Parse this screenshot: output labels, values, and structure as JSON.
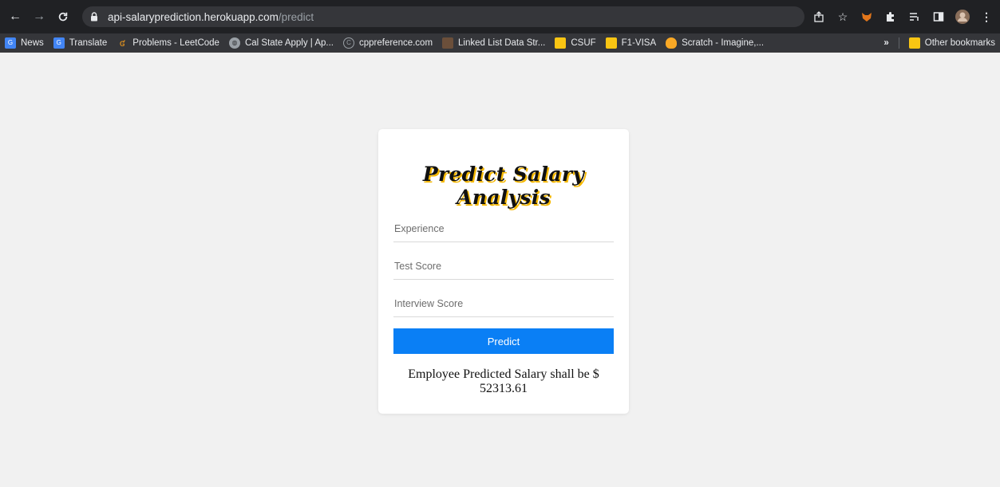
{
  "browser": {
    "url_host": "api-salaryprediction.herokuapp.com",
    "url_path": "/predict",
    "bookmarks": [
      {
        "label": "News",
        "color": "#4285f4",
        "icon": "news-icon"
      },
      {
        "label": "Translate",
        "color": "#4285f4",
        "icon": "translate-icon"
      },
      {
        "label": "Problems - LeetCode",
        "color": "#f89f1b",
        "icon": "leetcode-icon"
      },
      {
        "label": "Cal State Apply | Ap...",
        "color": "#9aa0a6",
        "icon": "globe-icon"
      },
      {
        "label": "cppreference.com",
        "color": "#9aa0a6",
        "icon": "cppreference-icon"
      },
      {
        "label": "Linked List Data Str...",
        "color": "#6b4f3a",
        "icon": "site-icon"
      },
      {
        "label": "CSUF",
        "color": "#f9c513",
        "icon": "folder-icon"
      },
      {
        "label": "F1-VISA",
        "color": "#f9c513",
        "icon": "folder-icon"
      },
      {
        "label": "Scratch - Imagine,...",
        "color": "#f9a825",
        "icon": "scratch-icon"
      }
    ],
    "more_label": "»",
    "other_bookmarks": "Other bookmarks"
  },
  "page": {
    "title": "Predict Salary Analysis",
    "fields": {
      "experience_placeholder": "Experience",
      "test_score_placeholder": "Test Score",
      "interview_score_placeholder": "Interview Score"
    },
    "predict_label": "Predict",
    "result_text": "Employee Predicted Salary shall be $ 52313.61",
    "accent_color": "#0a7ff5"
  }
}
